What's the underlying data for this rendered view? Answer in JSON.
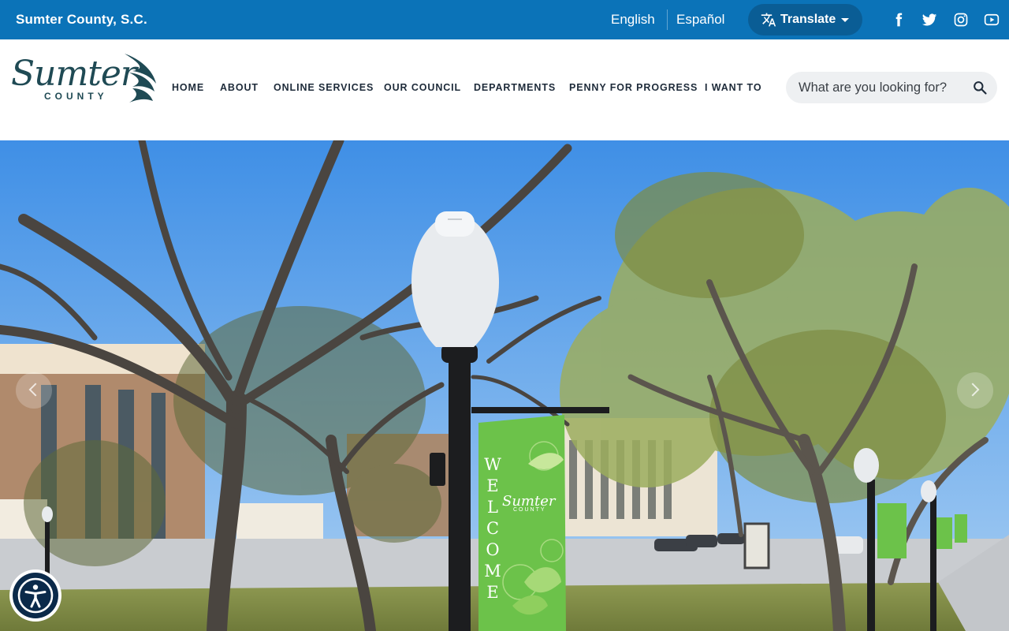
{
  "topbar": {
    "site_name": "Sumter County, S.C.",
    "languages": [
      "English",
      "Español"
    ],
    "translate_label": "Translate",
    "social": [
      "facebook-icon",
      "twitter-icon",
      "instagram-icon",
      "youtube-icon"
    ]
  },
  "header": {
    "logo": {
      "script": "Sumter",
      "subtitle": "COUNTY"
    },
    "nav": [
      "HOME",
      "ABOUT",
      "ONLINE SERVICES",
      "OUR COUNCIL",
      "DEPARTMENTS",
      "PENNY FOR PROGRESS",
      "I WANT TO"
    ],
    "search": {
      "placeholder": "What are you looking for?",
      "value": ""
    }
  },
  "hero": {
    "banner_text": "WELCOME",
    "banner_logo": "Sumter",
    "banner_logo_sub": "COUNTY"
  },
  "colors": {
    "topbar": "#0b73b8",
    "translate_button": "#0a5d95",
    "nav_text": "#1e2b3a",
    "logo": "#1f4a54",
    "banner": "#6cc24a",
    "accessibility": "#0b2a4a"
  }
}
